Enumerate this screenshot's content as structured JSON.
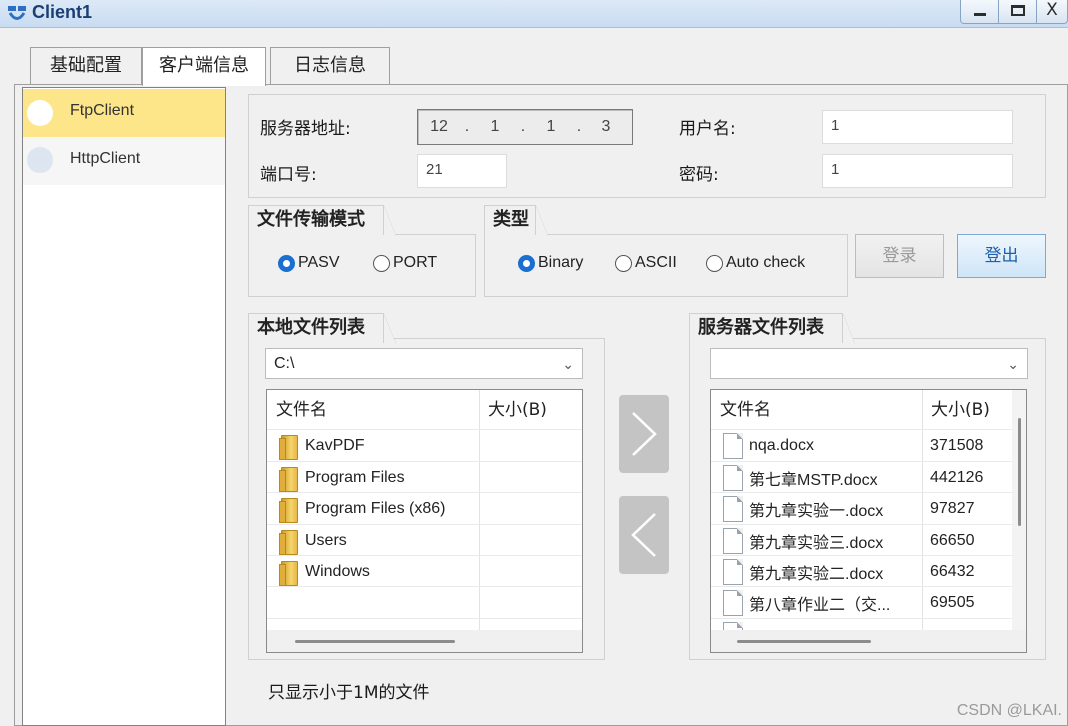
{
  "window": {
    "title": "Client1",
    "close_glyph": "X"
  },
  "tabs": [
    {
      "label": "基础配置"
    },
    {
      "label": "客户端信息"
    },
    {
      "label": "日志信息"
    }
  ],
  "client_list": [
    {
      "label": "FtpClient",
      "selected": true
    },
    {
      "label": "HttpClient",
      "selected": false
    }
  ],
  "connection": {
    "server_label": "服务器地址:",
    "ip": [
      "12",
      ".",
      "1",
      ".",
      "1",
      ".",
      "3"
    ],
    "port_label": "端口号:",
    "port_value": "21",
    "user_label": "用户名:",
    "user_value": "1",
    "password_label": "密码:",
    "password_value": "1"
  },
  "transfer_mode": {
    "title": "文件传输模式",
    "options": [
      {
        "label": "PASV",
        "checked": true
      },
      {
        "label": "PORT",
        "checked": false
      }
    ]
  },
  "type": {
    "title": "类型",
    "options": [
      {
        "label": "Binary",
        "checked": true
      },
      {
        "label": "ASCII",
        "checked": false
      },
      {
        "label": "Auto check",
        "checked": false
      }
    ]
  },
  "actions": {
    "login_label": "登录",
    "logout_label": "登出"
  },
  "local": {
    "title": "本地文件列表",
    "path": "C:\\",
    "columns": {
      "name": "文件名",
      "size": "大小(B)"
    },
    "files": [
      {
        "name": "KavPDF",
        "size": ""
      },
      {
        "name": "Program Files",
        "size": ""
      },
      {
        "name": "Program Files (x86)",
        "size": ""
      },
      {
        "name": "Users",
        "size": ""
      },
      {
        "name": "Windows",
        "size": ""
      }
    ]
  },
  "server": {
    "title": "服务器文件列表",
    "path": "",
    "columns": {
      "name": "文件名",
      "size": "大小(B)"
    },
    "files": [
      {
        "name": "nqa.docx",
        "size": "371508"
      },
      {
        "name": "第七章MSTP.docx",
        "size": "442126"
      },
      {
        "name": "第九章实验一.docx",
        "size": "97827"
      },
      {
        "name": "第九章实验三.docx",
        "size": "66650"
      },
      {
        "name": "第九章实验二.docx",
        "size": "66432"
      },
      {
        "name": "第八章作业二（交...",
        "size": "69505"
      }
    ]
  },
  "icons": {
    "upload": "chevron-right-icon",
    "download": "chevron-left-icon",
    "folder": "folder-icon",
    "document": "document-icon"
  },
  "footer": {
    "note": "只显示小于1M的文件",
    "watermark": "CSDN @LKAI."
  },
  "colors": {
    "selected_item": "#fde68a",
    "radio_checked": "#1a6fd0",
    "logout_text": "#1d5fab"
  }
}
